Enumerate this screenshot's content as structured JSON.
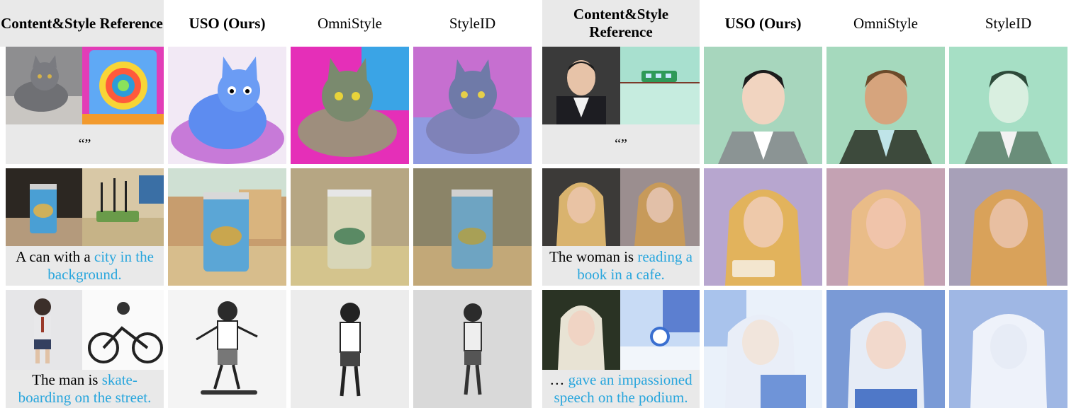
{
  "headers": {
    "reference": "Content&Style Reference",
    "ours": "USO (Ours)",
    "omnistyle": "OmniStyle",
    "styleid": "StyleID"
  },
  "left": {
    "row1": {
      "caption_plain": "“”",
      "caption_highlight": ""
    },
    "row2": {
      "caption_plain": "A can with a ",
      "caption_highlight": "city in the background."
    },
    "row3": {
      "caption_plain": "The man is ",
      "caption_highlight": "skate-boarding on the street."
    }
  },
  "right": {
    "row1": {
      "caption_plain": "“”",
      "caption_highlight": ""
    },
    "row2": {
      "caption_plain": "The woman is ",
      "caption_highlight": "reading a book in a cafe."
    },
    "row3": {
      "caption_plain": "… ",
      "caption_highlight": "gave an impassioned speech on the podium."
    }
  },
  "colors": {
    "highlight": "#29a6dd",
    "reference_bg": "#e9e9e9"
  },
  "images": {
    "l_r1_content": "photo-gray-cat-icon",
    "l_r1_style": "colorful-washing-machine-icon",
    "l_r1_uso": "cartoon-blue-cat-icon",
    "l_r1_omni": "painted-cat-icon",
    "l_r1_styleid": "painted-cat-icon",
    "l_r2_content": "photo-can-icon",
    "l_r2_style": "router-illustration-icon",
    "l_r2_uso": "illustrated-can-city-icon",
    "l_r2_omni": "illustrated-can-icon",
    "l_r2_styleid": "illustrated-can-icon",
    "l_r3_content": "boy-figure-icon",
    "l_r3_style": "motorcycle-sketch-icon",
    "l_r3_uso": "sketch-skateboarder-icon",
    "l_r3_omni": "sketch-boy-icon",
    "l_r3_styleid": "sketch-boy-icon",
    "r_r1_content": "photo-man-portrait-icon",
    "r_r1_style": "green-train-illustration-icon",
    "r_r1_uso": "flat-man-portrait-icon",
    "r_r1_omni": "painted-man-portrait-icon",
    "r_r1_styleid": "painted-man-portrait-icon",
    "r_r2_content": "photo-woman-portrait-icon",
    "r_r2_style": "painted-girl-icon",
    "r_r2_uso": "painted-woman-reading-icon",
    "r_r2_omni": "painted-woman-portrait-icon",
    "r_r2_styleid": "painted-woman-portrait-icon",
    "r_r3_content": "photo-elf-woman-icon",
    "r_r3_style": "watercolor-clock-icon",
    "r_r3_uso": "watercolor-elf-podium-icon",
    "r_r3_omni": "watercolor-elf-icon",
    "r_r3_styleid": "watercolor-elf-icon"
  }
}
